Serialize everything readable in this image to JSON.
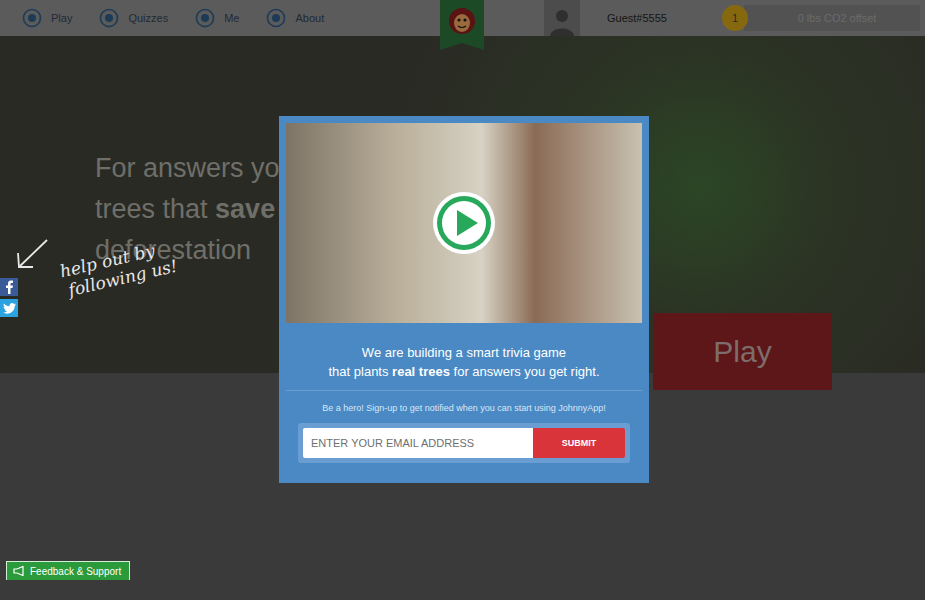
{
  "nav": {
    "items": [
      {
        "label": "Play"
      },
      {
        "label": "Quizzes"
      },
      {
        "label": "Me"
      },
      {
        "label": "About"
      }
    ],
    "user": {
      "name": "Guest#5555"
    },
    "coins": "1",
    "offset": "0 lbs CO2 offset"
  },
  "hero": {
    "lines": [
      [
        {
          "text": "For answers yo",
          "bold": false
        }
      ],
      [
        {
          "text": "trees that ",
          "bold": false
        },
        {
          "text": "save",
          "bold": true
        }
      ],
      [
        {
          "text": "deforestation",
          "bold": false
        }
      ]
    ],
    "play": "Play"
  },
  "social": {
    "caption": [
      "help out by",
      "following us!"
    ]
  },
  "modal": {
    "headline": [
      [
        {
          "text": "We are building a smart trivia game",
          "bold": false
        }
      ],
      [
        {
          "text": "that plants ",
          "bold": false
        },
        {
          "text": "real trees",
          "bold": true
        },
        {
          "text": " for answers you get right.",
          "bold": false
        }
      ]
    ],
    "subline": "Be a hero! Sign-up to get notified when you can start using JohnnyApp!",
    "email": {
      "placeholder": "ENTER YOUR EMAIL ADDRESS"
    },
    "submit": "SUBMIT"
  },
  "feedback": "Feedback & Support"
}
